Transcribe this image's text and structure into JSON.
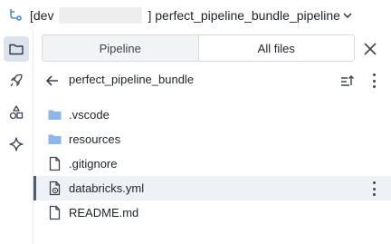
{
  "header": {
    "title_prefix": "[dev",
    "title_suffix": "] perfect_pipeline_bundle_pipeline"
  },
  "tabs": [
    {
      "label": "Pipeline",
      "selected": false
    },
    {
      "label": "All files",
      "selected": true
    }
  ],
  "path": {
    "current_folder": "perfect_pipeline_bundle"
  },
  "files": [
    {
      "name": ".vscode",
      "type": "folder"
    },
    {
      "name": "resources",
      "type": "folder"
    },
    {
      "name": ".gitignore",
      "type": "file"
    },
    {
      "name": "databricks.yml",
      "type": "config-file",
      "selected": true
    },
    {
      "name": "README.md",
      "type": "file"
    }
  ],
  "colors": {
    "folder": "#8fb6e8",
    "accent": "#4a5d7a",
    "active_rail": "#dde3ec"
  }
}
